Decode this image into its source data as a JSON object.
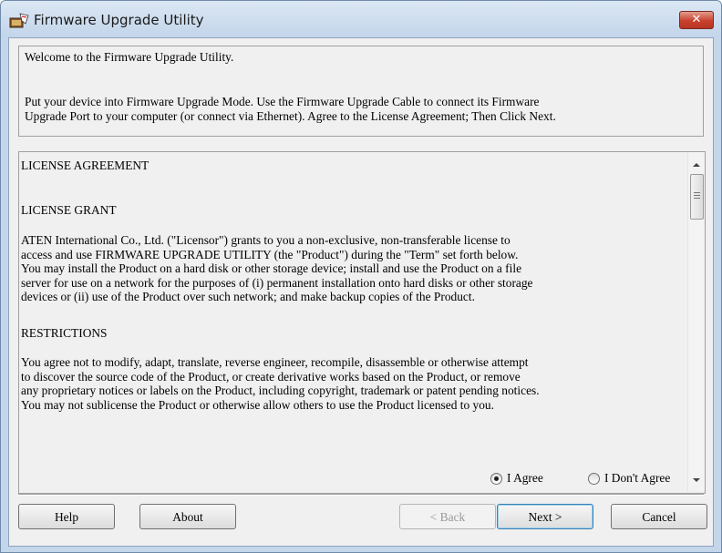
{
  "window": {
    "title": "Firmware Upgrade Utility",
    "close_label": "✕",
    "app_icon": "firmware-app-icon",
    "title_bar_color": "#c9daec"
  },
  "instructions": {
    "line1": "Welcome to the Firmware Upgrade Utility.",
    "line2": "Put your device into Firmware Upgrade Mode. Use the Firmware Upgrade Cable to connect its Firmware",
    "line3": "Upgrade Port to your computer (or connect via Ethernet). Agree to the License Agreement; Then Click Next."
  },
  "license": {
    "heading": "LICENSE AGREEMENT",
    "grant_heading": "LICENSE GRANT",
    "grant_lines": [
      "ATEN International Co., Ltd. (\"Licensor\") grants to you a non-exclusive, non-transferable license to",
      "access and use FIRMWARE UPGRADE UTILITY (the \"Product\") during the \"Term\" set forth below.",
      "You may install the Product on a hard disk or other storage device; install and use the Product on a file",
      "server for use on a network for the purposes of (i) permanent installation onto hard disks or other storage",
      "devices or (ii) use of the Product over such network; and make backup copies of the Product."
    ],
    "restrictions_heading": "RESTRICTIONS",
    "restriction_lines": [
      "You agree not to modify, adapt, translate, reverse engineer, recompile, disassemble or otherwise attempt",
      "to discover the source code of the Product, or create derivative works based on the Product, or remove",
      "any proprietary notices or labels on the Product, including copyright, trademark or patent pending notices.",
      "You may not sublicense the Product or otherwise allow others to use the Product licensed to you."
    ]
  },
  "agreement": {
    "agree_label": "I Agree",
    "disagree_label": "I Don't Agree",
    "selected": "I Agree"
  },
  "buttons": {
    "help": "Help",
    "about": "About",
    "back": "< Back",
    "next": "Next >",
    "cancel": "Cancel"
  }
}
